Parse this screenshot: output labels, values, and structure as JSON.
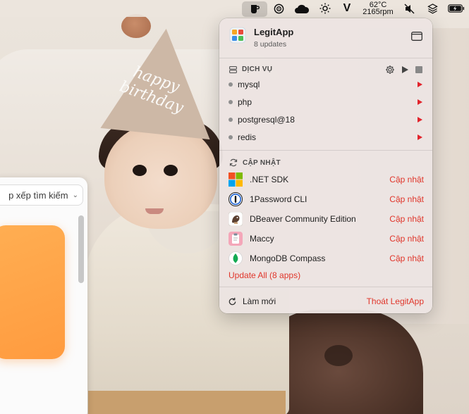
{
  "menubar": {
    "temp": "62°C",
    "rpm": "2165rpm",
    "icons": [
      "coffee-cup-icon",
      "clock-icon",
      "cloud-icon",
      "brightness-icon",
      "v-icon",
      "mute-icon",
      "layers-icon",
      "battery-charging-icon"
    ]
  },
  "panel": {
    "app_name": "LegitApp",
    "updates_count": "8 updates",
    "services": {
      "heading": "DỊCH VỤ",
      "items": [
        {
          "label": "mysql"
        },
        {
          "label": "php"
        },
        {
          "label": "postgresql@18"
        },
        {
          "label": "redis"
        }
      ]
    },
    "updates": {
      "heading": "CẬP NHẬT",
      "items": [
        {
          "label": ".NET SDK",
          "action": "Cập nhật",
          "icon": "microsoft-icon"
        },
        {
          "label": "1Password CLI",
          "action": "Cập nhật",
          "icon": "onepassword-icon"
        },
        {
          "label": "DBeaver Community Edition",
          "action": "Cập nhật",
          "icon": "dbeaver-icon"
        },
        {
          "label": "Maccy",
          "action": "Cập nhật",
          "icon": "maccy-icon"
        },
        {
          "label": "MongoDB Compass",
          "action": "Cập nhật",
          "icon": "mongodb-icon"
        }
      ],
      "update_all": "Update All (8 apps)"
    },
    "footer": {
      "refresh": "Làm mới",
      "quit": "Thoát LegitApp"
    }
  },
  "background_window": {
    "sort_label": "p xếp tìm kiếm"
  },
  "hat_text": "happy birthday",
  "colors": {
    "accent_red": "#e0362b",
    "arrow_red": "#e2242c",
    "card_orange": "#ff9b3f"
  }
}
